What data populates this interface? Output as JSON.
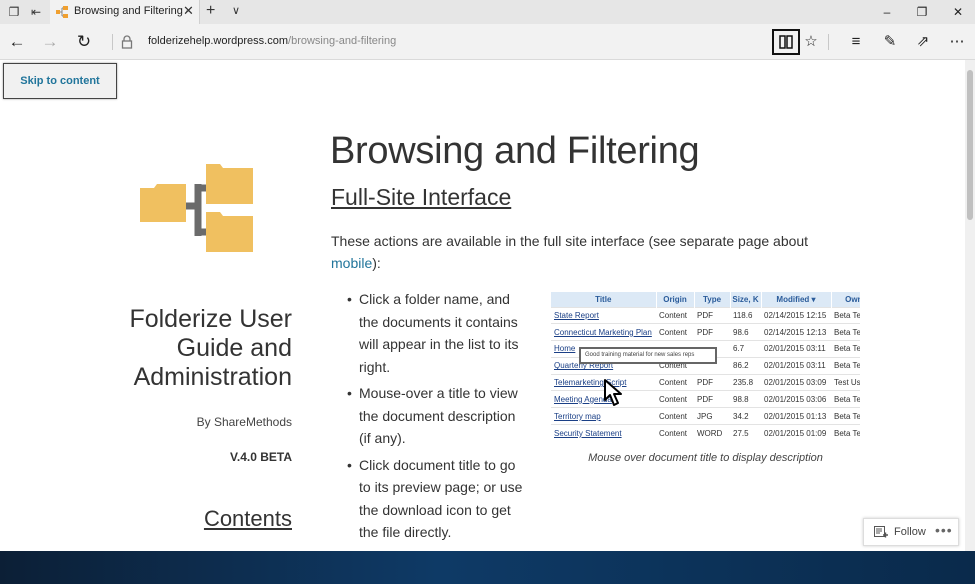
{
  "browser": {
    "tab_title": "Browsing and Filtering -",
    "url_host": "folderizehelp.wordpress.com",
    "url_path": "/browsing-and-filtering",
    "url_prefix": "folderizehelp."
  },
  "page": {
    "skip_link": "Skip to content",
    "site_title": "Folderize User Guide and Administration",
    "byline": "By ShareMethods",
    "version": "V.4.0 BETA",
    "contents": "Contents",
    "title": "Browsing and Filtering",
    "section_title": "Full-Site Interface",
    "intro_text": "These actions are available in the full site interface (see separate page about",
    "intro_link": "mobile",
    "intro_end": "):",
    "bullets": [
      "Click a folder name, and the documents it contains will appear in the list to its right.",
      "Mouse-over a title to view the document description (if any).",
      "Click document title to go to its preview page; or use the download icon to get the file directly."
    ],
    "figure": {
      "headers": [
        "Title",
        "Origin",
        "Type",
        "Size, K",
        "Modified",
        "Owne"
      ],
      "rows": [
        [
          "State Report",
          "Content",
          "PDF",
          "118.6",
          "02/14/2015 12:15",
          "Beta Tes"
        ],
        [
          "Connecticut Marketing Plan",
          "Content",
          "PDF",
          "98.6",
          "02/14/2015 12:13",
          "Beta Tes"
        ],
        [
          "Home",
          "",
          "",
          "6.7",
          "02/01/2015 03:11",
          "Beta Tes"
        ],
        [
          "Quarterly Report",
          "Content",
          "",
          "86.2",
          "02/01/2015 03:11",
          "Beta Tes"
        ],
        [
          "Telemarketing Script",
          "Content",
          "PDF",
          "235.8",
          "02/01/2015 03:09",
          "Test Use"
        ],
        [
          "Meeting Agenda",
          "Content",
          "PDF",
          "98.8",
          "02/01/2015 03:06",
          "Beta Tes"
        ],
        [
          "Territory map",
          "Content",
          "JPG",
          "34.2",
          "02/01/2015 01:13",
          "Beta Tes"
        ],
        [
          "Security Statement",
          "Content",
          "WORD",
          "27.5",
          "02/01/2015 01:09",
          "Beta Tes"
        ]
      ],
      "tooltip": "Good training material for new sales reps",
      "caption": "Mouse over document title to display description"
    },
    "follow_label": "Follow",
    "follow_more": "•••"
  },
  "colors": {
    "link": "#21759b",
    "folder": "#f0c060",
    "connector": "#6b6b6b"
  }
}
